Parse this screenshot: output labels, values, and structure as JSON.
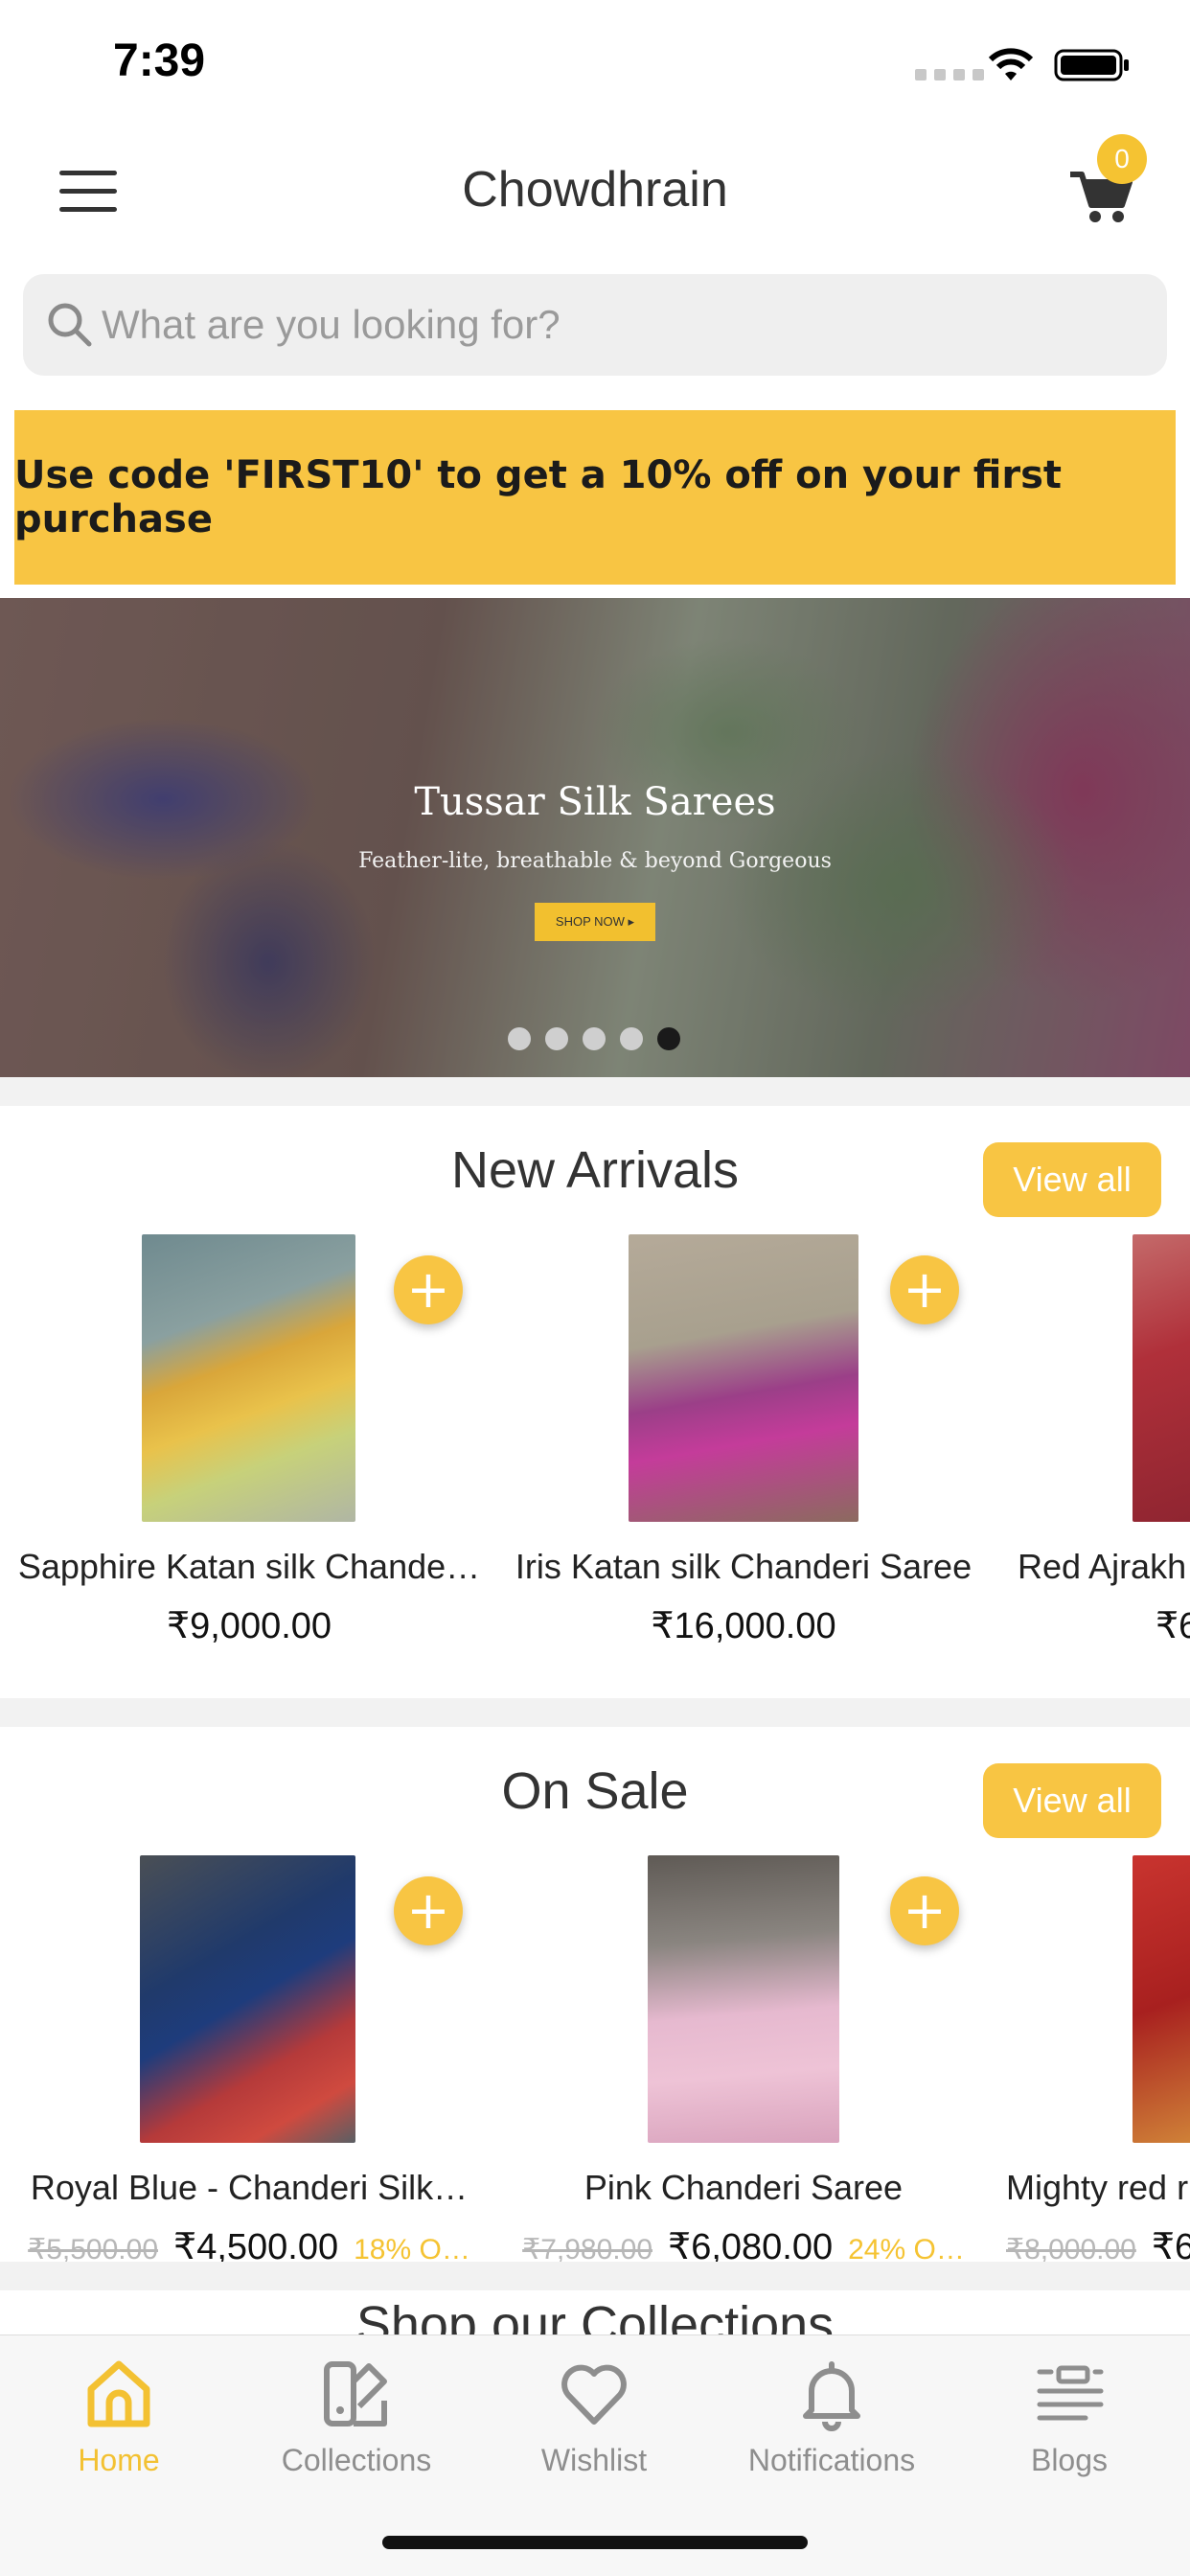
{
  "status_bar": {
    "time": "7:39"
  },
  "header": {
    "title": "Chowdhrain",
    "cart_count": "0"
  },
  "search": {
    "placeholder": "What are you looking for?"
  },
  "promo": {
    "text": "Use code 'FIRST10' to get a 10% off on your first purchase"
  },
  "banner": {
    "title": "Tussar Silk Sarees",
    "subtitle": "Feather-lite, breathable & beyond Gorgeous",
    "button": "SHOP NOW ▸",
    "slide_count": 5,
    "active_slide": 5
  },
  "new_arrivals": {
    "title": "New Arrivals",
    "view_all": "View all",
    "products": [
      {
        "name": "Sapphire Katan silk Chande…",
        "price": "₹9,000.00"
      },
      {
        "name": "Iris Katan silk Chanderi Saree",
        "price": "₹16,000.00"
      },
      {
        "name": "Red Ajrakh",
        "price": "₹6"
      }
    ]
  },
  "on_sale": {
    "title": "On Sale",
    "view_all": "View all",
    "products": [
      {
        "name": "Royal Blue - Chanderi Silk…",
        "old_price": "₹5,500.00",
        "price": "₹4,500.00",
        "discount": "18% O…"
      },
      {
        "name": "Pink Chanderi Saree",
        "old_price": "₹7,980.00",
        "price": "₹6,080.00",
        "discount": "24% O…"
      },
      {
        "name": "Mighty red r",
        "old_price": "₹8,000.00",
        "price": "₹6",
        "discount": ""
      }
    ]
  },
  "collections": {
    "title": "Shop our Collections"
  },
  "bottom_nav": {
    "items": [
      {
        "label": "Home",
        "icon": "home-icon",
        "active": true
      },
      {
        "label": "Collections",
        "icon": "collections-icon"
      },
      {
        "label": "Wishlist",
        "icon": "heart-icon"
      },
      {
        "label": "Notifications",
        "icon": "bell-icon"
      },
      {
        "label": "Blogs",
        "icon": "blogs-icon"
      }
    ]
  },
  "colors": {
    "accent": "#f8c543",
    "accent_text": "#f3c132",
    "nav_inactive": "#8e8e8e"
  }
}
